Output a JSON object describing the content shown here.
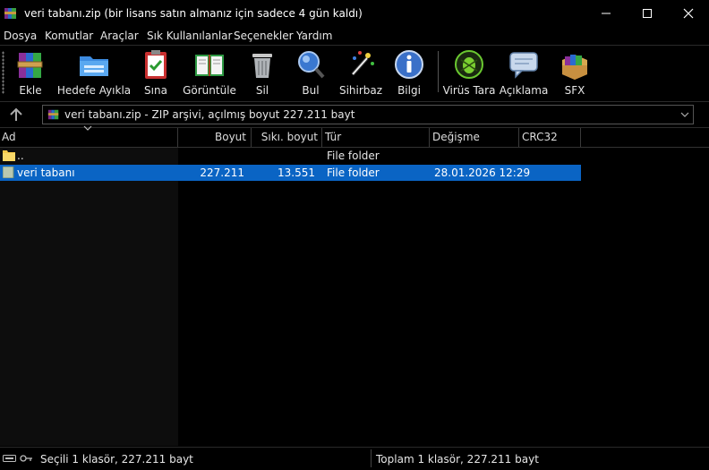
{
  "window": {
    "title": "veri tabanı.zip (bir lisans satın almanız için sadece 4 gün kaldı)"
  },
  "menu": [
    "Dosya",
    "Komutlar",
    "Araçlar",
    "Sık Kullanılanlar",
    "Seçenekler",
    "Yardım"
  ],
  "toolbar": {
    "add": "Ekle",
    "extract": "Hedefe Ayıkla",
    "test": "Sına",
    "view": "Görüntüle",
    "delete": "Sil",
    "find": "Bul",
    "wizard": "Sihirbaz",
    "info": "Bilgi",
    "virus": "Virüs Tara",
    "comment": "Açıklama",
    "sfx": "SFX"
  },
  "address": {
    "text": "veri tabanı.zip - ZIP arşivi, açılmış boyut 227.211 bayt"
  },
  "columns": {
    "name": "Ad",
    "size": "Boyut",
    "packed": "Sıkı. boyut",
    "type": "Tür",
    "modified": "Değişme",
    "crc": "CRC32"
  },
  "rows": [
    {
      "name": "..",
      "size": "",
      "packed": "",
      "type": "File folder",
      "modified": "",
      "crc": ""
    },
    {
      "name": "veri tabanı",
      "size": "227.211",
      "packed": "13.551",
      "type": "File folder",
      "modified": "28.01.2026 12:29",
      "crc": ""
    }
  ],
  "status": {
    "left": "Seçili 1 klasör, 227.211 bayt",
    "right": "Toplam 1 klasör, 227.211 bayt"
  },
  "colors": {
    "selection": "#0a64c4",
    "background": "#000000",
    "text": "#e6e6e6"
  }
}
